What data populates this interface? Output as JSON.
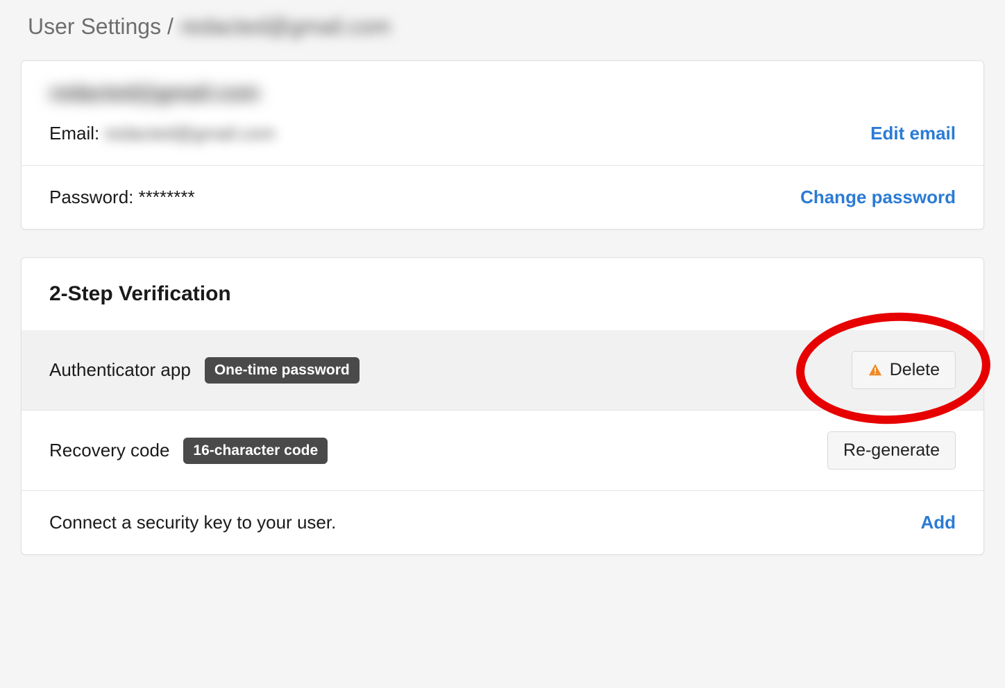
{
  "breadcrumb": {
    "prefix": "User Settings /",
    "user": "redacted@gmail.com"
  },
  "account": {
    "username_display": "redacted@gmail.com",
    "email_label": "Email:",
    "email_value": "redacted@gmail.com",
    "edit_email_label": "Edit email",
    "password_label": "Password:",
    "password_value": "********",
    "change_password_label": "Change password"
  },
  "two_step": {
    "title": "2-Step Verification",
    "authenticator_label": "Authenticator app",
    "authenticator_badge": "One-time password",
    "delete_label": "Delete",
    "recovery_label": "Recovery code",
    "recovery_badge": "16-character code",
    "regenerate_label": "Re-generate",
    "security_key_text": "Connect a security key to your user.",
    "add_label": "Add"
  },
  "colors": {
    "link": "#2b7bd4",
    "highlight": "#e60000",
    "warning_icon": "#f08a24"
  }
}
